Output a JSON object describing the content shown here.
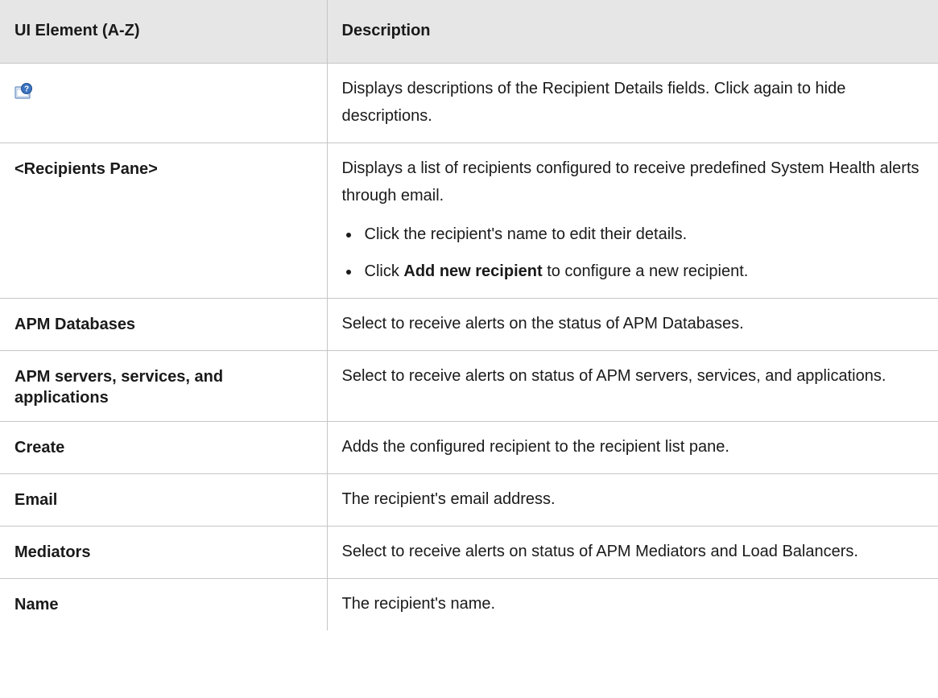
{
  "header": {
    "col1": "UI Element (A-Z)",
    "col2": "Description"
  },
  "rows": [
    {
      "icon": "show-descriptions-icon",
      "description": "Displays descriptions of the Recipient Details fields. Click again to hide descriptions."
    },
    {
      "element": "<Recipients Pane>",
      "description": "Displays a list of recipients configured to receive predefined System Health alerts through email.",
      "bullets": [
        {
          "text": "Click the recipient's name to edit their details."
        },
        {
          "prefix": "Click ",
          "bold": "Add new recipient",
          "suffix": " to configure a new recipient."
        }
      ]
    },
    {
      "element": "APM Databases",
      "description": "Select to receive alerts on the status of APM Databases."
    },
    {
      "element": "APM servers, services, and applications",
      "description": "Select to receive alerts on status of APM servers, services, and applications."
    },
    {
      "element": "Create",
      "description": "Adds the configured recipient to the recipient list pane."
    },
    {
      "element": "Email",
      "description": "The recipient's email address."
    },
    {
      "element": "Mediators",
      "description": "Select to receive alerts on status of APM Mediators and Load Balancers."
    },
    {
      "element": "Name",
      "description": "The recipient's name."
    }
  ]
}
